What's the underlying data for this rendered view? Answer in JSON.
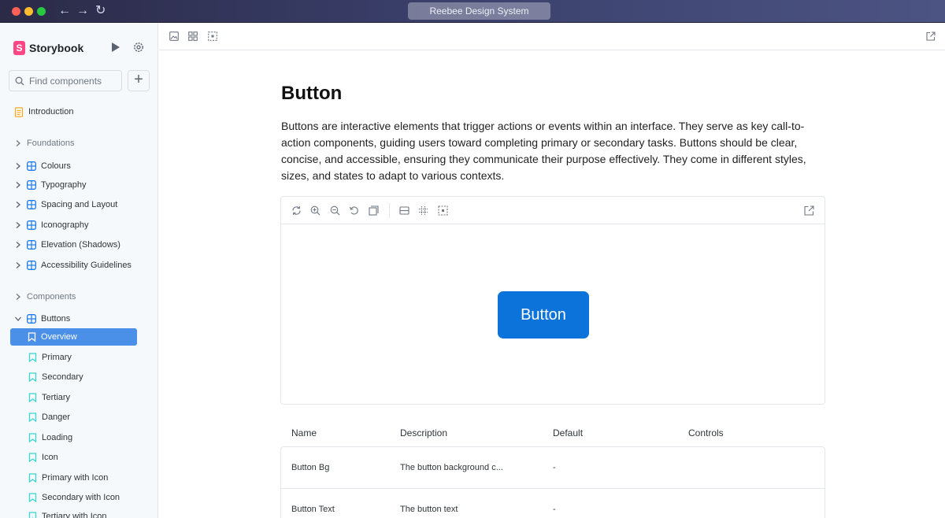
{
  "window": {
    "title": "Reebee Design System"
  },
  "sidebar": {
    "brand": "Storybook",
    "search_placeholder": "Find components",
    "introduction": "Introduction",
    "groups": {
      "foundations": "Foundations",
      "components": "Components"
    },
    "foundations": [
      "Colours",
      "Typography",
      "Spacing and Layout",
      "Iconography",
      "Elevation (Shadows)",
      "Accessibility Guidelines"
    ],
    "buttons_label": "Buttons",
    "stories": [
      "Overview",
      "Primary",
      "Secondary",
      "Tertiary",
      "Danger",
      "Loading",
      "Icon",
      "Primary with Icon",
      "Secondary with Icon",
      "Tertiary with Icon"
    ]
  },
  "page": {
    "title": "Button",
    "description": "Buttons are interactive elements that trigger actions or events within an interface. They serve as key call-to-action components, guiding users toward completing primary or secondary tasks. Buttons should be clear, concise, and accessible, ensuring they communicate their purpose effectively. They come in different styles, sizes, and states to adapt to various contexts.",
    "demo_button": "Button"
  },
  "args_table": {
    "headers": [
      "Name",
      "Description",
      "Default",
      "Controls"
    ],
    "rows": [
      {
        "name": "Button Bg",
        "description": "The button background c...",
        "default": "-"
      },
      {
        "name": "Button Text",
        "description": "The button text",
        "default": "-"
      }
    ]
  },
  "colors": {
    "accent": "#4a8fe8",
    "button": "#0b73d9",
    "brand": "#ff4785"
  }
}
